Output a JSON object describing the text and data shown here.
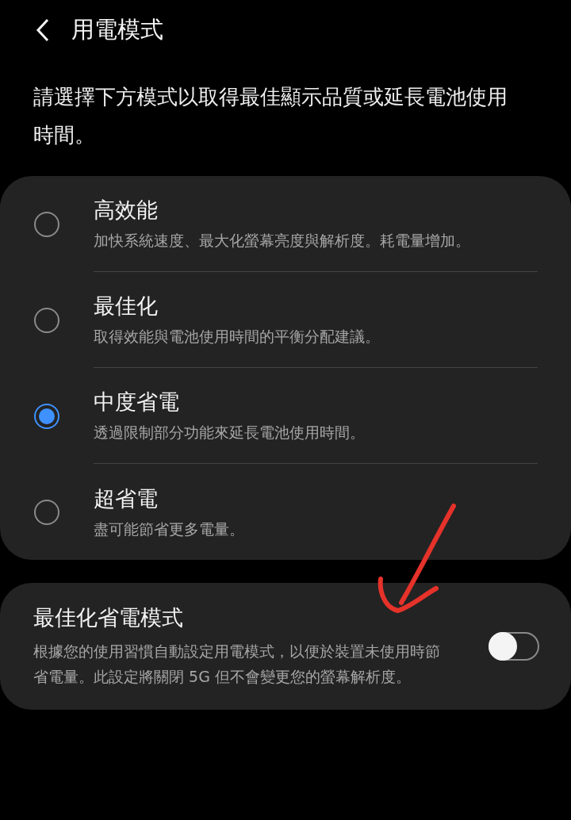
{
  "header": {
    "title": "用電模式"
  },
  "description": "請選擇下方模式以取得最佳顯示品質或延長電池使用時間。",
  "modes": [
    {
      "title": "高效能",
      "subtitle": "加快系統速度、最大化螢幕亮度與解析度。耗電量增加。",
      "selected": false
    },
    {
      "title": "最佳化",
      "subtitle": "取得效能與電池使用時間的平衡分配建議。",
      "selected": false
    },
    {
      "title": "中度省電",
      "subtitle": "透過限制部分功能來延長電池使用時間。",
      "selected": true
    },
    {
      "title": "超省電",
      "subtitle": "盡可能節省更多電量。",
      "selected": false
    }
  ],
  "adaptive": {
    "title": "最佳化省電模式",
    "description": "根據您的使用習慣自動設定用電模式，以便於裝置未使用時節省電量。此設定將關閉 5G 但不會變更您的螢幕解析度。",
    "on": false
  }
}
